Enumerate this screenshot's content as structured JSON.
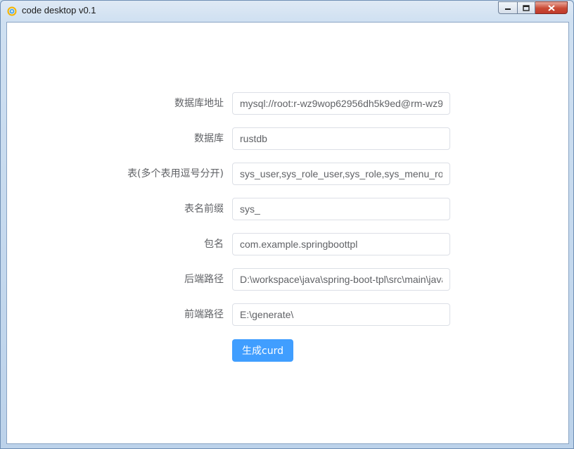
{
  "window": {
    "title": "code desktop v0.1"
  },
  "form": {
    "fields": [
      {
        "label": "数据库地址",
        "value": "mysql://root:r-wz9wop62956dh5k9ed@rm-wz9"
      },
      {
        "label": "数据库",
        "value": "rustdb"
      },
      {
        "label": "表(多个表用逗号分开)",
        "value": "sys_user,sys_role_user,sys_role,sys_menu_ro"
      },
      {
        "label": "表名前缀",
        "value": "sys_"
      },
      {
        "label": "包名",
        "value": "com.example.springboottpl"
      },
      {
        "label": "后端路径",
        "value": "D:\\workspace\\java\\spring-boot-tpl\\src\\main\\java"
      },
      {
        "label": "前端路径",
        "value": "E:\\generate\\"
      }
    ],
    "submit_label": "生成curd"
  },
  "colors": {
    "primary": "#409eff",
    "label": "#606266",
    "border": "#dcdfe6"
  }
}
